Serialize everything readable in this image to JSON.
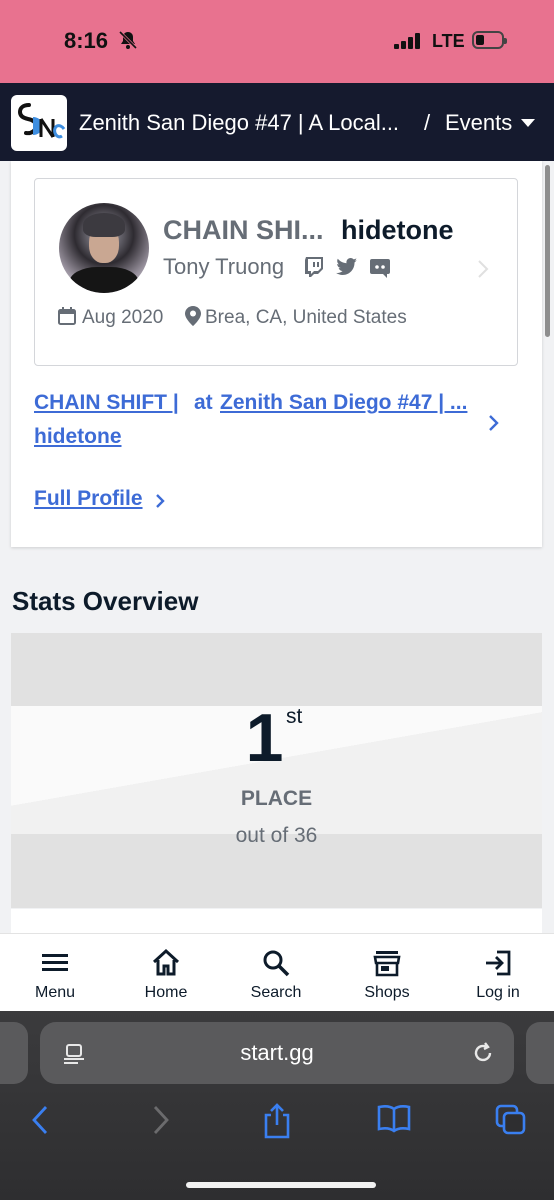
{
  "status_bar": {
    "time": "8:16",
    "network": "LTE"
  },
  "header": {
    "title": "Zenith San Diego #47 | A Local...",
    "separator": "/",
    "events_label": "Events"
  },
  "profile": {
    "tag_prefix": "CHAIN SHI...",
    "gamertag": "hidetone",
    "real_name": "Tony Truong",
    "join_date": "Aug 2020",
    "location": "Brea, CA, United States"
  },
  "entrant": {
    "link_line1": "CHAIN SHIFT |",
    "at": "at",
    "tournament": "Zenith San Diego #47 | ...",
    "link_line2": "hidetone"
  },
  "full_profile": "Full Profile",
  "stats": {
    "title": "Stats Overview",
    "placement": 1,
    "placement_text": "1",
    "suffix": "st",
    "place_label": "PLACE",
    "out_of": "out of 36"
  },
  "bottom_nav": {
    "items": [
      {
        "label": "Menu",
        "icon": "menu-icon"
      },
      {
        "label": "Home",
        "icon": "home-icon"
      },
      {
        "label": "Search",
        "icon": "search-icon"
      },
      {
        "label": "Shops",
        "icon": "shop-icon"
      },
      {
        "label": "Log in",
        "icon": "login-icon"
      }
    ]
  },
  "browser": {
    "url": "start.gg"
  },
  "colors": {
    "status_bar": "#e8728f",
    "header": "#151a2e",
    "link": "#3d6bd6",
    "text_dark": "#0d1b2a",
    "text_muted": "#666d76"
  }
}
